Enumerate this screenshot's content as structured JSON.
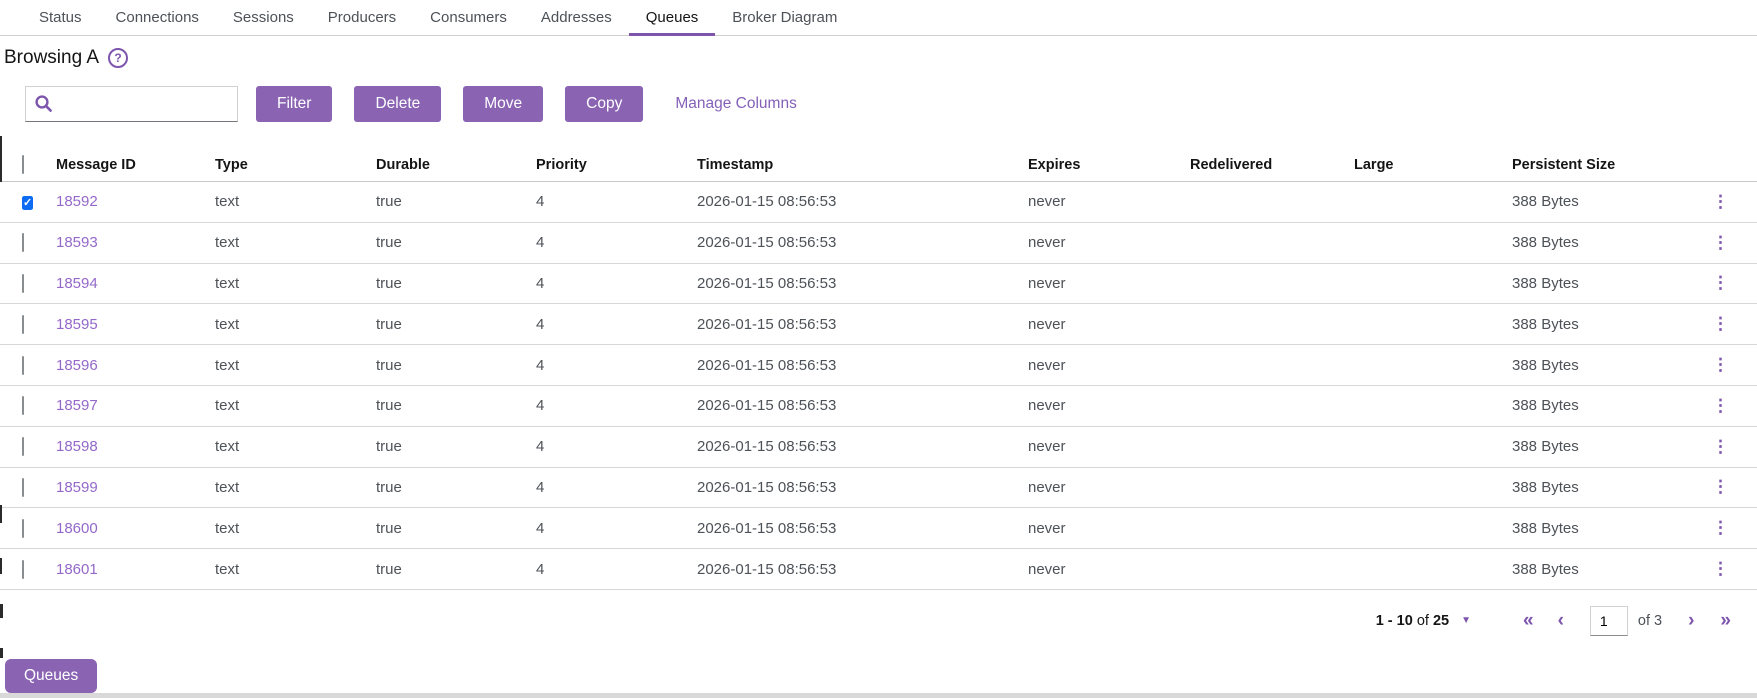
{
  "tabs": [
    {
      "label": "Status",
      "active": false
    },
    {
      "label": "Connections",
      "active": false
    },
    {
      "label": "Sessions",
      "active": false
    },
    {
      "label": "Producers",
      "active": false
    },
    {
      "label": "Consumers",
      "active": false
    },
    {
      "label": "Addresses",
      "active": false
    },
    {
      "label": "Queues",
      "active": true
    },
    {
      "label": "Broker Diagram",
      "active": false
    }
  ],
  "page": {
    "title": "Browsing A",
    "help_icon": "question-circle-icon"
  },
  "toolbar": {
    "search_value": "",
    "search_placeholder": "",
    "search_icon": "search-icon",
    "buttons": [
      {
        "label": "Filter"
      },
      {
        "label": "Delete"
      },
      {
        "label": "Move"
      },
      {
        "label": "Copy"
      }
    ],
    "manage_columns_label": "Manage Columns"
  },
  "table": {
    "columns": [
      "Message ID",
      "Type",
      "Durable",
      "Priority",
      "Timestamp",
      "Expires",
      "Redelivered",
      "Large",
      "Persistent Size"
    ],
    "rows": [
      {
        "checked": true,
        "id": "18592",
        "type": "text",
        "durable": "true",
        "priority": "4",
        "timestamp": "2026-01-15 08:56:53",
        "expires": "never",
        "redelivered": "",
        "large": "",
        "persistent_size": "388 Bytes"
      },
      {
        "checked": false,
        "id": "18593",
        "type": "text",
        "durable": "true",
        "priority": "4",
        "timestamp": "2026-01-15 08:56:53",
        "expires": "never",
        "redelivered": "",
        "large": "",
        "persistent_size": "388 Bytes"
      },
      {
        "checked": false,
        "id": "18594",
        "type": "text",
        "durable": "true",
        "priority": "4",
        "timestamp": "2026-01-15 08:56:53",
        "expires": "never",
        "redelivered": "",
        "large": "",
        "persistent_size": "388 Bytes"
      },
      {
        "checked": false,
        "id": "18595",
        "type": "text",
        "durable": "true",
        "priority": "4",
        "timestamp": "2026-01-15 08:56:53",
        "expires": "never",
        "redelivered": "",
        "large": "",
        "persistent_size": "388 Bytes"
      },
      {
        "checked": false,
        "id": "18596",
        "type": "text",
        "durable": "true",
        "priority": "4",
        "timestamp": "2026-01-15 08:56:53",
        "expires": "never",
        "redelivered": "",
        "large": "",
        "persistent_size": "388 Bytes"
      },
      {
        "checked": false,
        "id": "18597",
        "type": "text",
        "durable": "true",
        "priority": "4",
        "timestamp": "2026-01-15 08:56:53",
        "expires": "never",
        "redelivered": "",
        "large": "",
        "persistent_size": "388 Bytes"
      },
      {
        "checked": false,
        "id": "18598",
        "type": "text",
        "durable": "true",
        "priority": "4",
        "timestamp": "2026-01-15 08:56:53",
        "expires": "never",
        "redelivered": "",
        "large": "",
        "persistent_size": "388 Bytes"
      },
      {
        "checked": false,
        "id": "18599",
        "type": "text",
        "durable": "true",
        "priority": "4",
        "timestamp": "2026-01-15 08:56:53",
        "expires": "never",
        "redelivered": "",
        "large": "",
        "persistent_size": "388 Bytes"
      },
      {
        "checked": false,
        "id": "18600",
        "type": "text",
        "durable": "true",
        "priority": "4",
        "timestamp": "2026-01-15 08:56:53",
        "expires": "never",
        "redelivered": "",
        "large": "",
        "persistent_size": "388 Bytes"
      },
      {
        "checked": false,
        "id": "18601",
        "type": "text",
        "durable": "true",
        "priority": "4",
        "timestamp": "2026-01-15 08:56:53",
        "expires": "never",
        "redelivered": "",
        "large": "",
        "persistent_size": "388 Bytes"
      }
    ],
    "kebab_icon": "kebab-menu-icon"
  },
  "pagination": {
    "range_first_last": "1 - 10",
    "of_word": "of",
    "range_total": "25",
    "per_page_caret_icon": "chevron-down-icon",
    "first_icon": "«",
    "prev_icon": "‹",
    "page_value": "1",
    "of_pages_label": "of 3",
    "next_icon": "›",
    "last_icon": "»"
  },
  "footer": {
    "queues_button_label": "Queues"
  },
  "colors": {
    "accent_purple": "#8a63b3",
    "accent_dark_purple": "#7d55ad",
    "link_purple": "#9468c9",
    "checkbox_checked_blue": "#0d6cf2"
  }
}
